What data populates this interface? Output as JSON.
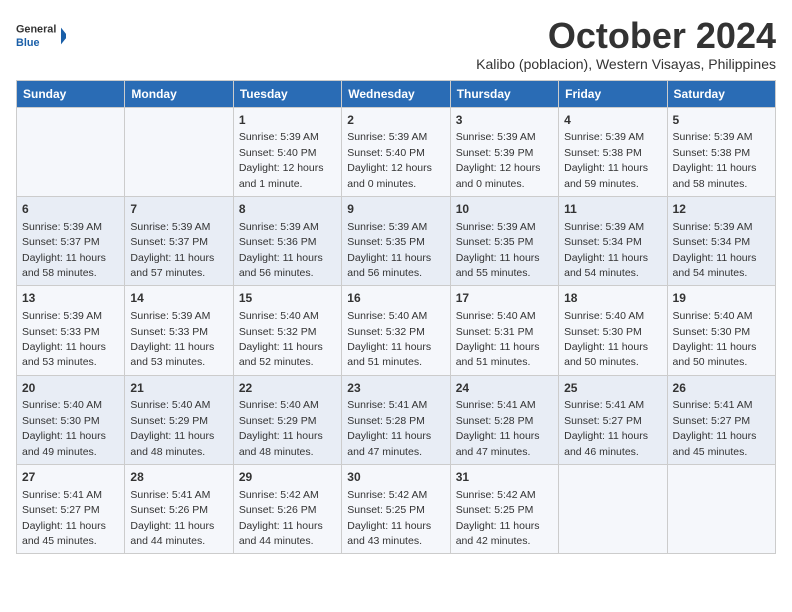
{
  "logo": {
    "general": "General",
    "blue": "Blue"
  },
  "title": "October 2024",
  "subtitle": "Kalibo (poblacion), Western Visayas, Philippines",
  "weekdays": [
    "Sunday",
    "Monday",
    "Tuesday",
    "Wednesday",
    "Thursday",
    "Friday",
    "Saturday"
  ],
  "weeks": [
    [
      {
        "day": "",
        "detail": ""
      },
      {
        "day": "",
        "detail": ""
      },
      {
        "day": "1",
        "detail": "Sunrise: 5:39 AM\nSunset: 5:40 PM\nDaylight: 12 hours\nand 1 minute."
      },
      {
        "day": "2",
        "detail": "Sunrise: 5:39 AM\nSunset: 5:40 PM\nDaylight: 12 hours\nand 0 minutes."
      },
      {
        "day": "3",
        "detail": "Sunrise: 5:39 AM\nSunset: 5:39 PM\nDaylight: 12 hours\nand 0 minutes."
      },
      {
        "day": "4",
        "detail": "Sunrise: 5:39 AM\nSunset: 5:38 PM\nDaylight: 11 hours\nand 59 minutes."
      },
      {
        "day": "5",
        "detail": "Sunrise: 5:39 AM\nSunset: 5:38 PM\nDaylight: 11 hours\nand 58 minutes."
      }
    ],
    [
      {
        "day": "6",
        "detail": "Sunrise: 5:39 AM\nSunset: 5:37 PM\nDaylight: 11 hours\nand 58 minutes."
      },
      {
        "day": "7",
        "detail": "Sunrise: 5:39 AM\nSunset: 5:37 PM\nDaylight: 11 hours\nand 57 minutes."
      },
      {
        "day": "8",
        "detail": "Sunrise: 5:39 AM\nSunset: 5:36 PM\nDaylight: 11 hours\nand 56 minutes."
      },
      {
        "day": "9",
        "detail": "Sunrise: 5:39 AM\nSunset: 5:35 PM\nDaylight: 11 hours\nand 56 minutes."
      },
      {
        "day": "10",
        "detail": "Sunrise: 5:39 AM\nSunset: 5:35 PM\nDaylight: 11 hours\nand 55 minutes."
      },
      {
        "day": "11",
        "detail": "Sunrise: 5:39 AM\nSunset: 5:34 PM\nDaylight: 11 hours\nand 54 minutes."
      },
      {
        "day": "12",
        "detail": "Sunrise: 5:39 AM\nSunset: 5:34 PM\nDaylight: 11 hours\nand 54 minutes."
      }
    ],
    [
      {
        "day": "13",
        "detail": "Sunrise: 5:39 AM\nSunset: 5:33 PM\nDaylight: 11 hours\nand 53 minutes."
      },
      {
        "day": "14",
        "detail": "Sunrise: 5:39 AM\nSunset: 5:33 PM\nDaylight: 11 hours\nand 53 minutes."
      },
      {
        "day": "15",
        "detail": "Sunrise: 5:40 AM\nSunset: 5:32 PM\nDaylight: 11 hours\nand 52 minutes."
      },
      {
        "day": "16",
        "detail": "Sunrise: 5:40 AM\nSunset: 5:32 PM\nDaylight: 11 hours\nand 51 minutes."
      },
      {
        "day": "17",
        "detail": "Sunrise: 5:40 AM\nSunset: 5:31 PM\nDaylight: 11 hours\nand 51 minutes."
      },
      {
        "day": "18",
        "detail": "Sunrise: 5:40 AM\nSunset: 5:30 PM\nDaylight: 11 hours\nand 50 minutes."
      },
      {
        "day": "19",
        "detail": "Sunrise: 5:40 AM\nSunset: 5:30 PM\nDaylight: 11 hours\nand 50 minutes."
      }
    ],
    [
      {
        "day": "20",
        "detail": "Sunrise: 5:40 AM\nSunset: 5:30 PM\nDaylight: 11 hours\nand 49 minutes."
      },
      {
        "day": "21",
        "detail": "Sunrise: 5:40 AM\nSunset: 5:29 PM\nDaylight: 11 hours\nand 48 minutes."
      },
      {
        "day": "22",
        "detail": "Sunrise: 5:40 AM\nSunset: 5:29 PM\nDaylight: 11 hours\nand 48 minutes."
      },
      {
        "day": "23",
        "detail": "Sunrise: 5:41 AM\nSunset: 5:28 PM\nDaylight: 11 hours\nand 47 minutes."
      },
      {
        "day": "24",
        "detail": "Sunrise: 5:41 AM\nSunset: 5:28 PM\nDaylight: 11 hours\nand 47 minutes."
      },
      {
        "day": "25",
        "detail": "Sunrise: 5:41 AM\nSunset: 5:27 PM\nDaylight: 11 hours\nand 46 minutes."
      },
      {
        "day": "26",
        "detail": "Sunrise: 5:41 AM\nSunset: 5:27 PM\nDaylight: 11 hours\nand 45 minutes."
      }
    ],
    [
      {
        "day": "27",
        "detail": "Sunrise: 5:41 AM\nSunset: 5:27 PM\nDaylight: 11 hours\nand 45 minutes."
      },
      {
        "day": "28",
        "detail": "Sunrise: 5:41 AM\nSunset: 5:26 PM\nDaylight: 11 hours\nand 44 minutes."
      },
      {
        "day": "29",
        "detail": "Sunrise: 5:42 AM\nSunset: 5:26 PM\nDaylight: 11 hours\nand 44 minutes."
      },
      {
        "day": "30",
        "detail": "Sunrise: 5:42 AM\nSunset: 5:25 PM\nDaylight: 11 hours\nand 43 minutes."
      },
      {
        "day": "31",
        "detail": "Sunrise: 5:42 AM\nSunset: 5:25 PM\nDaylight: 11 hours\nand 42 minutes."
      },
      {
        "day": "",
        "detail": ""
      },
      {
        "day": "",
        "detail": ""
      }
    ]
  ]
}
